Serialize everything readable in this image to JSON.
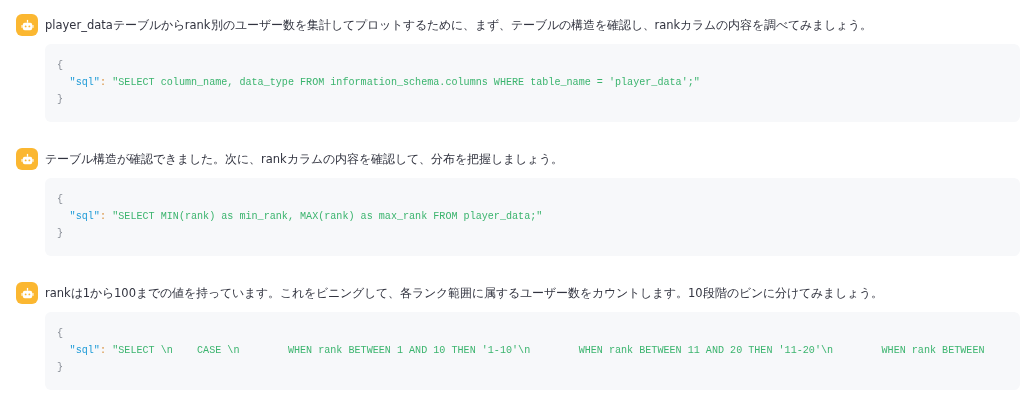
{
  "messages": [
    {
      "text": "player_dataテーブルからrank別のユーザー数を集計してプロットするために、まず、テーブルの構造を確認し、rankカラムの内容を調べてみましょう。",
      "code": [
        [
          {
            "kind": "punct",
            "text": "{"
          }
        ],
        [
          {
            "kind": "key",
            "text": "\"sql\""
          },
          {
            "kind": "colon",
            "text": ":"
          },
          {
            "kind": "string",
            "text": "\"SELECT column_name, data_type FROM information_schema.columns WHERE table_name = 'player_data';\""
          }
        ],
        [
          {
            "kind": "punct",
            "text": "}"
          }
        ]
      ]
    },
    {
      "text": "テーブル構造が確認できました。次に、rankカラムの内容を確認して、分布を把握しましょう。",
      "code": [
        [
          {
            "kind": "punct",
            "text": "{"
          }
        ],
        [
          {
            "kind": "key",
            "text": "\"sql\""
          },
          {
            "kind": "colon",
            "text": ":"
          },
          {
            "kind": "string",
            "text": "\"SELECT MIN(rank) as min_rank, MAX(rank) as max_rank FROM player_data;\""
          }
        ],
        [
          {
            "kind": "punct",
            "text": "}"
          }
        ]
      ]
    },
    {
      "text": "rankは1から100までの値を持っています。これをビニングして、各ランク範囲に属するユーザー数をカウントします。10段階のビンに分けてみましょう。",
      "code": [
        [
          {
            "kind": "punct",
            "text": "{"
          }
        ],
        [
          {
            "kind": "key",
            "text": "\"sql\""
          },
          {
            "kind": "colon",
            "text": ":"
          },
          {
            "kind": "string",
            "text": "\"SELECT \\n    CASE \\n        WHEN rank BETWEEN 1 AND 10 THEN '1-10'\\n        WHEN rank BETWEEN 11 AND 20 THEN '11-20'\\n        WHEN rank BETWEEN"
          }
        ],
        [
          {
            "kind": "punct",
            "text": "}"
          }
        ]
      ]
    }
  ]
}
